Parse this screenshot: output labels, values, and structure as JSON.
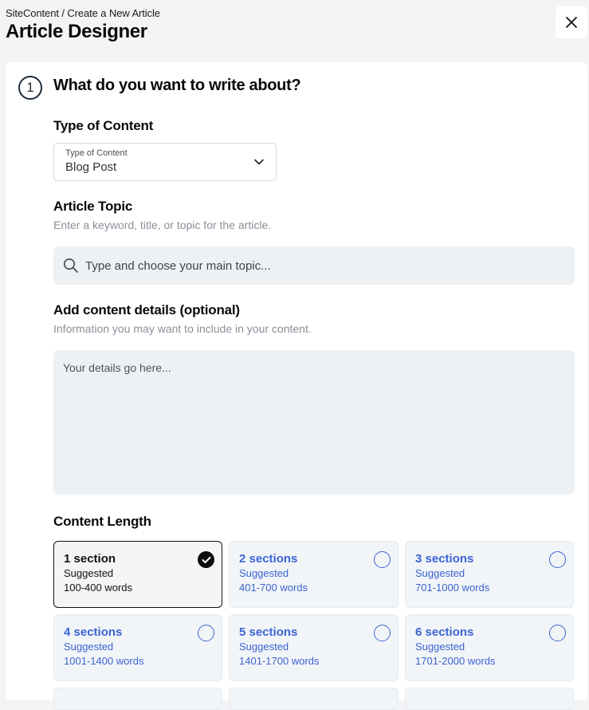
{
  "header": {
    "breadcrumb": "SiteContent / Create a New Article",
    "title": "Article Designer",
    "close_icon": "close-icon"
  },
  "step": {
    "number": "1",
    "title": "What do you want to write about?"
  },
  "content_type": {
    "heading": "Type of Content",
    "select_label": "Type of Content",
    "selected_value": "Blog Post",
    "chevron_icon": "chevron-down-icon"
  },
  "topic": {
    "heading": "Article Topic",
    "help": "Enter a keyword, title, or topic for the article.",
    "placeholder": "Type and choose your main topic...",
    "value": "",
    "search_icon": "search-icon"
  },
  "details": {
    "heading": "Add content details (optional)",
    "help": "Information you may want to include in your content.",
    "placeholder": "Your details go here...",
    "value": ""
  },
  "content_length": {
    "heading": "Content Length",
    "accent_color": "#3b63d6",
    "selected_index": 0,
    "options": [
      {
        "title": "1 section",
        "suggested": "Suggested",
        "words": "100-400 words",
        "selected": true
      },
      {
        "title": "2 sections",
        "suggested": "Suggested",
        "words": "401-700 words",
        "selected": false
      },
      {
        "title": "3 sections",
        "suggested": "Suggested",
        "words": "701-1000 words",
        "selected": false
      },
      {
        "title": "4 sections",
        "suggested": "Suggested",
        "words": "1001-1400 words",
        "selected": false
      },
      {
        "title": "5 sections",
        "suggested": "Suggested",
        "words": "1401-1700 words",
        "selected": false
      },
      {
        "title": "6 sections",
        "suggested": "Suggested",
        "words": "1701-2000 words",
        "selected": false
      }
    ]
  }
}
